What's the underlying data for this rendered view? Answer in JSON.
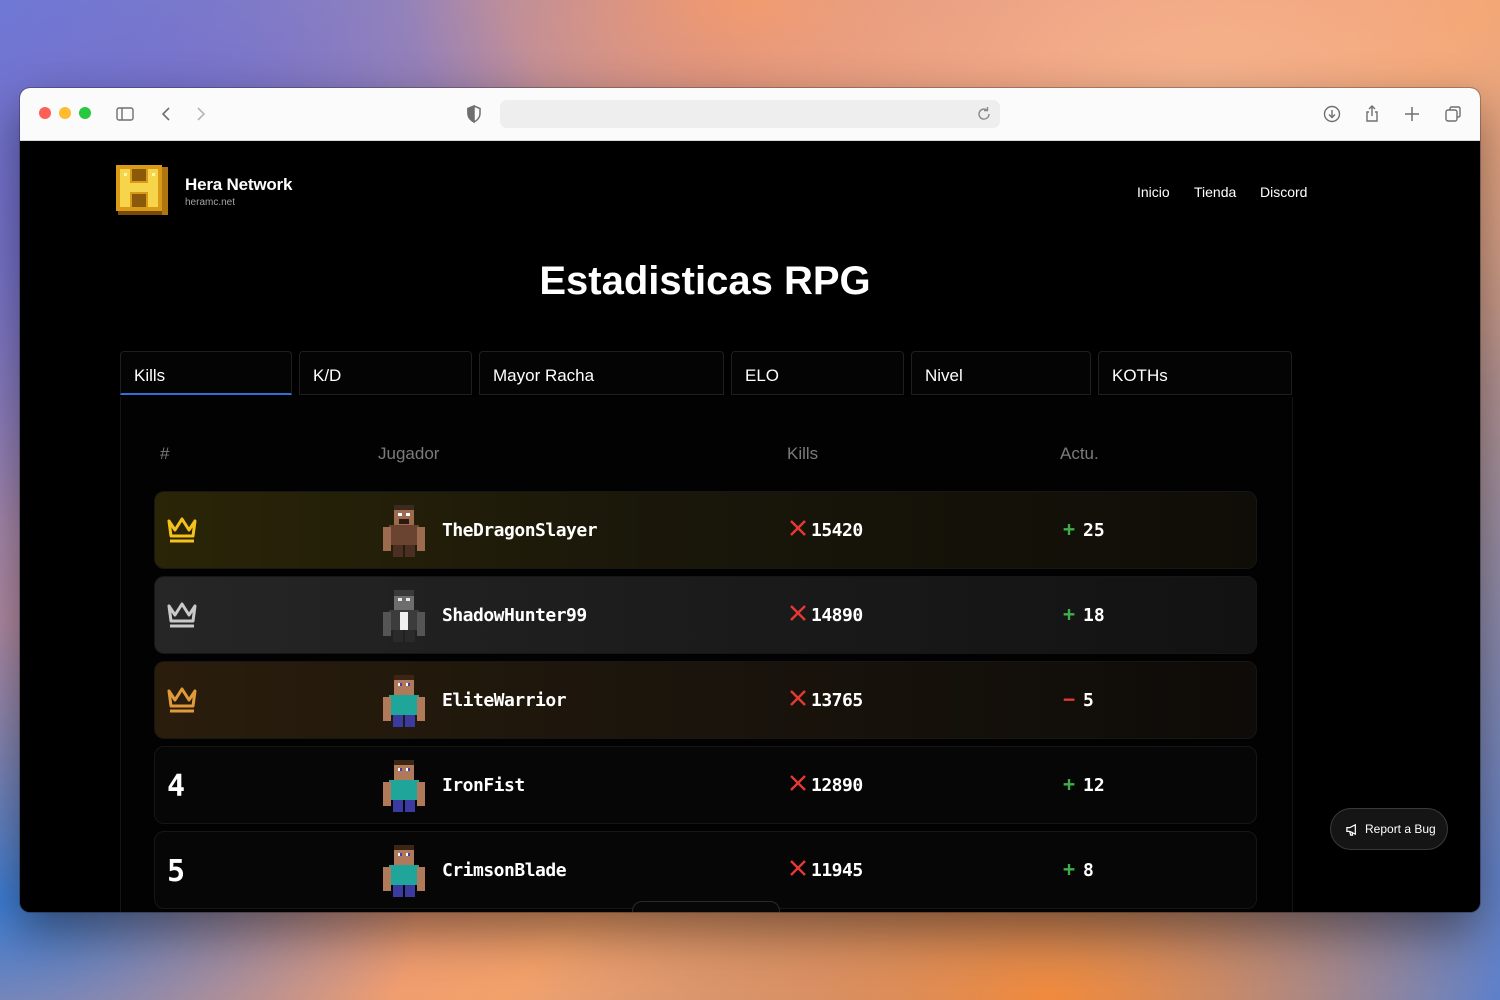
{
  "brand": {
    "name": "Hera Network",
    "domain": "heramc.net"
  },
  "nav": [
    {
      "label": "Inicio"
    },
    {
      "label": "Tienda"
    },
    {
      "label": "Discord"
    }
  ],
  "page_title": "Estadisticas RPG",
  "tabs": [
    {
      "label": "Kills",
      "active": true
    },
    {
      "label": "K/D",
      "active": false
    },
    {
      "label": "Mayor Racha",
      "active": false
    },
    {
      "label": "ELO",
      "active": false
    },
    {
      "label": "Nivel",
      "active": false
    },
    {
      "label": "KOTHs",
      "active": false
    }
  ],
  "table": {
    "headers": {
      "rank": "#",
      "player": "Jugador",
      "kills": "Kills",
      "change": "Actu."
    },
    "rows": [
      {
        "rank": "1",
        "rank_icon": "gold-crown-icon",
        "player": "TheDragonSlayer",
        "kills": "15420",
        "change_sign": "+",
        "change": "25"
      },
      {
        "rank": "2",
        "rank_icon": "silver-crown-icon",
        "player": "ShadowHunter99",
        "kills": "14890",
        "change_sign": "+",
        "change": "18"
      },
      {
        "rank": "3",
        "rank_icon": "bronze-crown-icon",
        "player": "EliteWarrior",
        "kills": "13765",
        "change_sign": "−",
        "change": "5"
      },
      {
        "rank": "4",
        "rank_icon": "",
        "player": "IronFist",
        "kills": "12890",
        "change_sign": "+",
        "change": "12"
      },
      {
        "rank": "5",
        "rank_icon": "",
        "player": "CrimsonBlade",
        "kills": "11945",
        "change_sign": "+",
        "change": "8"
      }
    ]
  },
  "report_bug": {
    "label": "Report a Bug"
  },
  "colors": {
    "gold": "#f4c21a",
    "silver": "#c9c9c9",
    "bronze": "#e09a3a",
    "tab_accent": "#2f6fd6",
    "up": "#3fae4a",
    "down": "#e53935"
  }
}
